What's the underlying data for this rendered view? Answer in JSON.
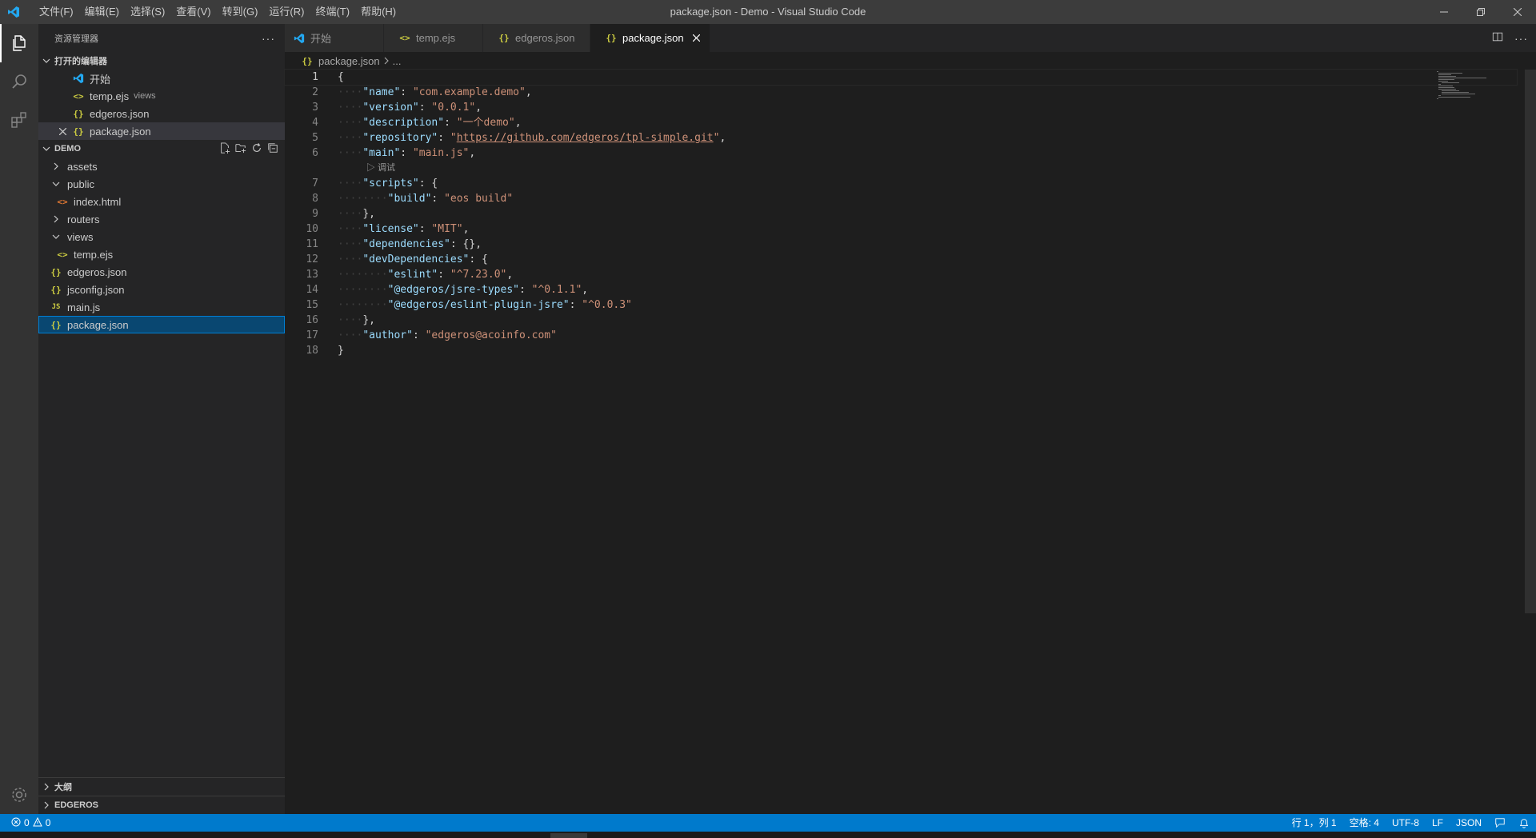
{
  "titlebar": {
    "title": "package.json - Demo - Visual Studio Code",
    "menu": [
      "文件(F)",
      "编辑(E)",
      "选择(S)",
      "查看(V)",
      "转到(G)",
      "运行(R)",
      "终端(T)",
      "帮助(H)"
    ]
  },
  "sidebar": {
    "title": "资源管理器",
    "open_editors": {
      "label": "打开的编辑器",
      "items": [
        {
          "name": "开始",
          "desc": ""
        },
        {
          "name": "temp.ejs",
          "desc": "views"
        },
        {
          "name": "edgeros.json",
          "desc": ""
        },
        {
          "name": "package.json",
          "desc": ""
        }
      ]
    },
    "workspace": {
      "label": "DEMO",
      "items": [
        "assets",
        "public",
        "index.html",
        "routers",
        "views",
        "temp.ejs",
        "edgeros.json",
        "jsconfig.json",
        "main.js",
        "package.json"
      ]
    },
    "outline_label": "大纲",
    "edgeros_label": "EDGEROS"
  },
  "tabs": [
    "开始",
    "temp.ejs",
    "edgeros.json",
    "package.json"
  ],
  "breadcrumb": {
    "file": "package.json",
    "more": "..."
  },
  "editor": {
    "line_numbers": [
      "1",
      "2",
      "3",
      "4",
      "5",
      "6",
      "7",
      "8",
      "9",
      "10",
      "11",
      "12",
      "13",
      "14",
      "15",
      "16",
      "17",
      "18"
    ],
    "codelens": "调试",
    "lines": [
      {
        "parts": [
          [
            "p",
            "{"
          ]
        ]
      },
      {
        "parts": [
          [
            "ws",
            "····"
          ],
          [
            "k",
            "\"name\""
          ],
          [
            "p",
            ": "
          ],
          [
            "s",
            "\"com.example.demo\""
          ],
          [
            "p",
            ","
          ]
        ]
      },
      {
        "parts": [
          [
            "ws",
            "····"
          ],
          [
            "k",
            "\"version\""
          ],
          [
            "p",
            ": "
          ],
          [
            "s",
            "\"0.0.1\""
          ],
          [
            "p",
            ","
          ]
        ]
      },
      {
        "parts": [
          [
            "ws",
            "····"
          ],
          [
            "k",
            "\"description\""
          ],
          [
            "p",
            ": "
          ],
          [
            "s",
            "\"一个demo\""
          ],
          [
            "p",
            ","
          ]
        ]
      },
      {
        "parts": [
          [
            "ws",
            "····"
          ],
          [
            "k",
            "\"repository\""
          ],
          [
            "p",
            ": "
          ],
          [
            "s",
            "\""
          ],
          [
            "u",
            "https://github.com/edgeros/tpl-simple.git"
          ],
          [
            "s",
            "\""
          ],
          [
            "p",
            ","
          ]
        ]
      },
      {
        "parts": [
          [
            "ws",
            "····"
          ],
          [
            "k",
            "\"main\""
          ],
          [
            "p",
            ": "
          ],
          [
            "s",
            "\"main.js\""
          ],
          [
            "p",
            ","
          ]
        ]
      },
      {
        "parts": [
          [
            "ws",
            "····"
          ],
          [
            "k",
            "\"scripts\""
          ],
          [
            "p",
            ": {"
          ]
        ]
      },
      {
        "parts": [
          [
            "ws",
            "········"
          ],
          [
            "k",
            "\"build\""
          ],
          [
            "p",
            ": "
          ],
          [
            "s",
            "\"eos build\""
          ]
        ]
      },
      {
        "parts": [
          [
            "ws",
            "····"
          ],
          [
            "p",
            "},"
          ]
        ]
      },
      {
        "parts": [
          [
            "ws",
            "····"
          ],
          [
            "k",
            "\"license\""
          ],
          [
            "p",
            ": "
          ],
          [
            "s",
            "\"MIT\""
          ],
          [
            "p",
            ","
          ]
        ]
      },
      {
        "parts": [
          [
            "ws",
            "····"
          ],
          [
            "k",
            "\"dependencies\""
          ],
          [
            "p",
            ": {},"
          ]
        ]
      },
      {
        "parts": [
          [
            "ws",
            "····"
          ],
          [
            "k",
            "\"devDependencies\""
          ],
          [
            "p",
            ": {"
          ]
        ]
      },
      {
        "parts": [
          [
            "ws",
            "········"
          ],
          [
            "k",
            "\"eslint\""
          ],
          [
            "p",
            ": "
          ],
          [
            "s",
            "\"^7.23.0\""
          ],
          [
            "p",
            ","
          ]
        ]
      },
      {
        "parts": [
          [
            "ws",
            "········"
          ],
          [
            "k",
            "\"@edgeros/jsre-types\""
          ],
          [
            "p",
            ": "
          ],
          [
            "s",
            "\"^0.1.1\""
          ],
          [
            "p",
            ","
          ]
        ]
      },
      {
        "parts": [
          [
            "ws",
            "········"
          ],
          [
            "k",
            "\"@edgeros/eslint-plugin-jsre\""
          ],
          [
            "p",
            ": "
          ],
          [
            "s",
            "\"^0.0.3\""
          ]
        ]
      },
      {
        "parts": [
          [
            "ws",
            "····"
          ],
          [
            "p",
            "},"
          ]
        ]
      },
      {
        "parts": [
          [
            "ws",
            "····"
          ],
          [
            "k",
            "\"author\""
          ],
          [
            "p",
            ": "
          ],
          [
            "s",
            "\"edgeros@acoinfo.com\""
          ]
        ]
      },
      {
        "parts": [
          [
            "p",
            "}"
          ]
        ]
      }
    ]
  },
  "statusbar": {
    "errors": "0",
    "warnings": "0",
    "position": "行 1，列 1",
    "spaces": "空格: 4",
    "encoding": "UTF-8",
    "eol": "LF",
    "language": "JSON"
  },
  "colors": {
    "accent": "#007acc",
    "key": "#9cdcfe",
    "string": "#ce9178"
  }
}
